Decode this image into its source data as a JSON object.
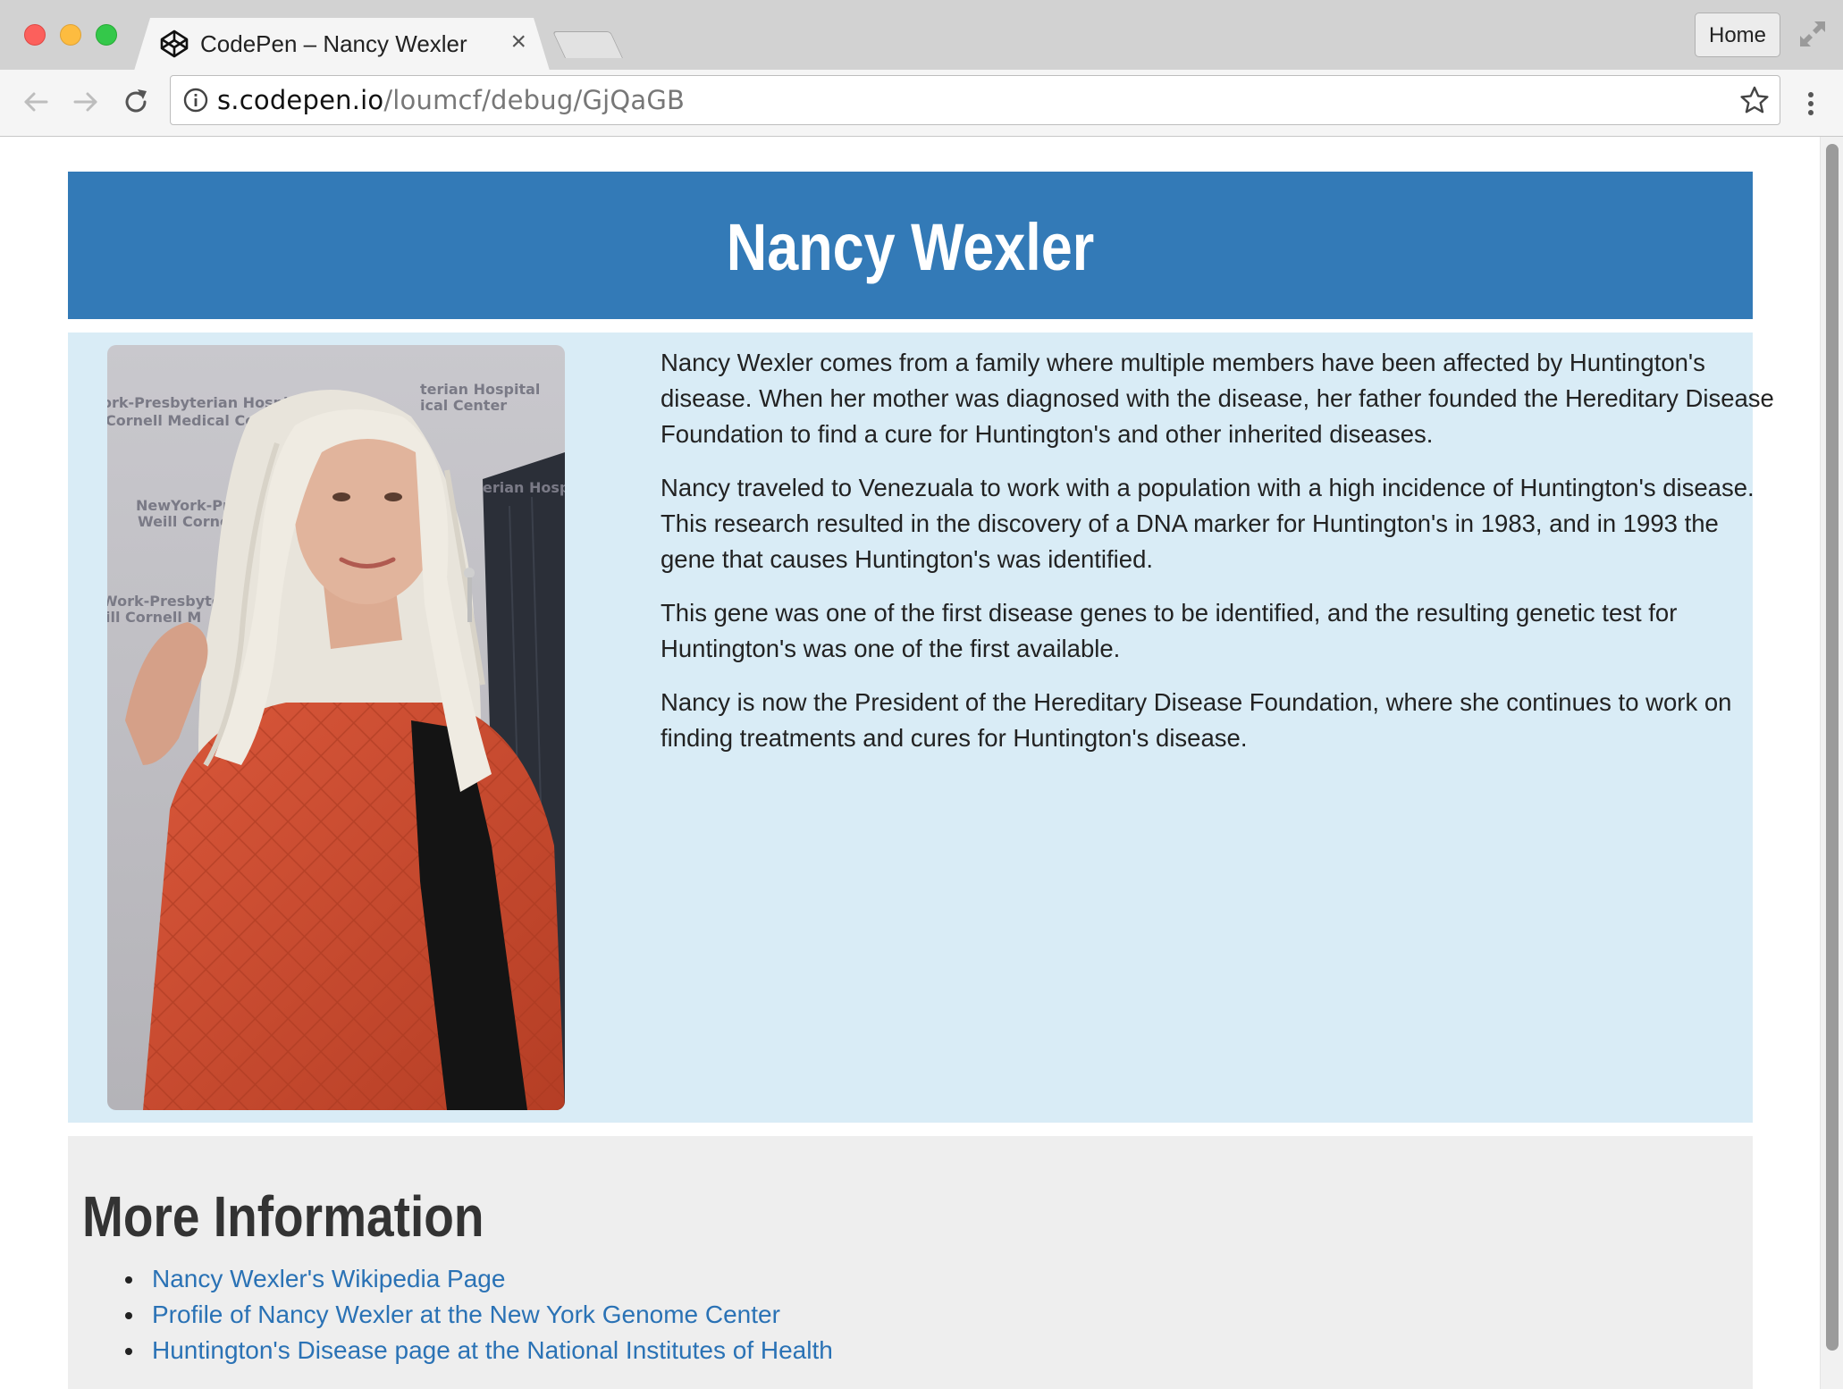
{
  "browser": {
    "tab_title": "CodePen – Nancy Wexler",
    "tab_close": "×",
    "home_label": "Home",
    "url_host": "s.codepen.io",
    "url_path": "/loumcf/debug/GjQaGB"
  },
  "page": {
    "title": "Nancy Wexler",
    "portrait_caption_text": "NewYork-Presbyterian Hospital Weill Cornell Medical Center",
    "bio_paragraphs": [
      "Nancy Wexler comes from a family where multiple members have been affected by Huntington's disease. When her mother was diagnosed with the disease, her father founded the Hereditary Disease Foundation to find a cure for Huntington's and other inherited diseases.",
      "Nancy traveled to Venezuala to work with a population with a high incidence of Huntington's disease. This research resulted in the discovery of a DNA marker for Huntington's in 1983, and in 1993 the gene that causes Huntington's was identified.",
      "This gene was one of the first disease genes to be identified, and the resulting genetic test for Huntington's was one of the first available.",
      "Nancy is now the President of the Hereditary Disease Foundation, where she continues to work on finding treatments and cures for Huntington's disease."
    ],
    "more_heading": "More Information",
    "links": [
      "Nancy Wexler's Wikipedia Page",
      "Profile of Nancy Wexler at the New York Genome Center",
      "Huntington's Disease page at the National Institutes of Health"
    ]
  },
  "colors": {
    "banner": "#337ab7",
    "bio_background": "#d9ecf6",
    "more_background": "#eeeeee",
    "link": "#2a72b5"
  }
}
